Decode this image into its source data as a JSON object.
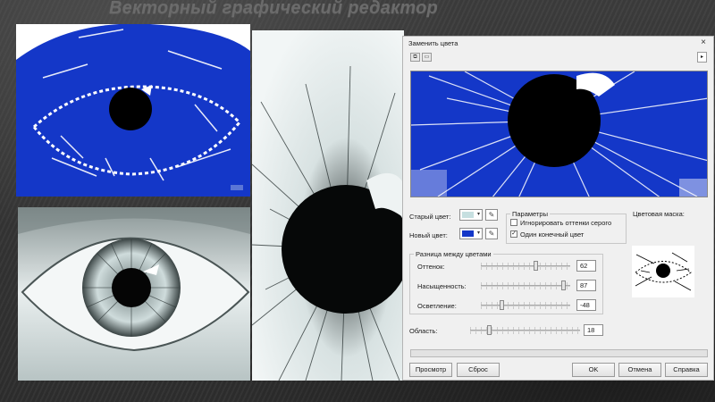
{
  "slide": {
    "title": "Векторный графический редактор"
  },
  "dialog": {
    "title": "Заменить цвета",
    "old_color_label": "Старый цвет:",
    "new_color_label": "Новый цвет:",
    "old_color": "#c6dfe0",
    "new_color": "#1437c8",
    "params": {
      "title": "Параметры",
      "ignore_gray_label": "Игнорировать оттенки серого",
      "ignore_gray_checked": false,
      "single_target_label": "Один конечный цвет",
      "single_target_checked": true
    },
    "mask_label": "Цветовая маска:",
    "diff_group_title": "Разница между цветами",
    "sliders": [
      {
        "label": "Оттенок:",
        "value": "62",
        "fraction": 0.62
      },
      {
        "label": "Насыщенность:",
        "value": "87",
        "fraction": 0.95
      },
      {
        "label": "Осветление:",
        "value": "-48",
        "fraction": 0.22
      }
    ],
    "area": {
      "label": "Область:",
      "value": "18",
      "fraction": 0.16
    },
    "buttons": {
      "preview": "Просмотр",
      "reset": "Сброс",
      "ok": "OK",
      "cancel": "Отмена",
      "help": "Справка"
    },
    "close_glyph": "×",
    "arrow_glyph": "▸"
  },
  "colors": {
    "replacement_blue": "#1437c8",
    "dialog_bg": "#f0f0f0"
  }
}
